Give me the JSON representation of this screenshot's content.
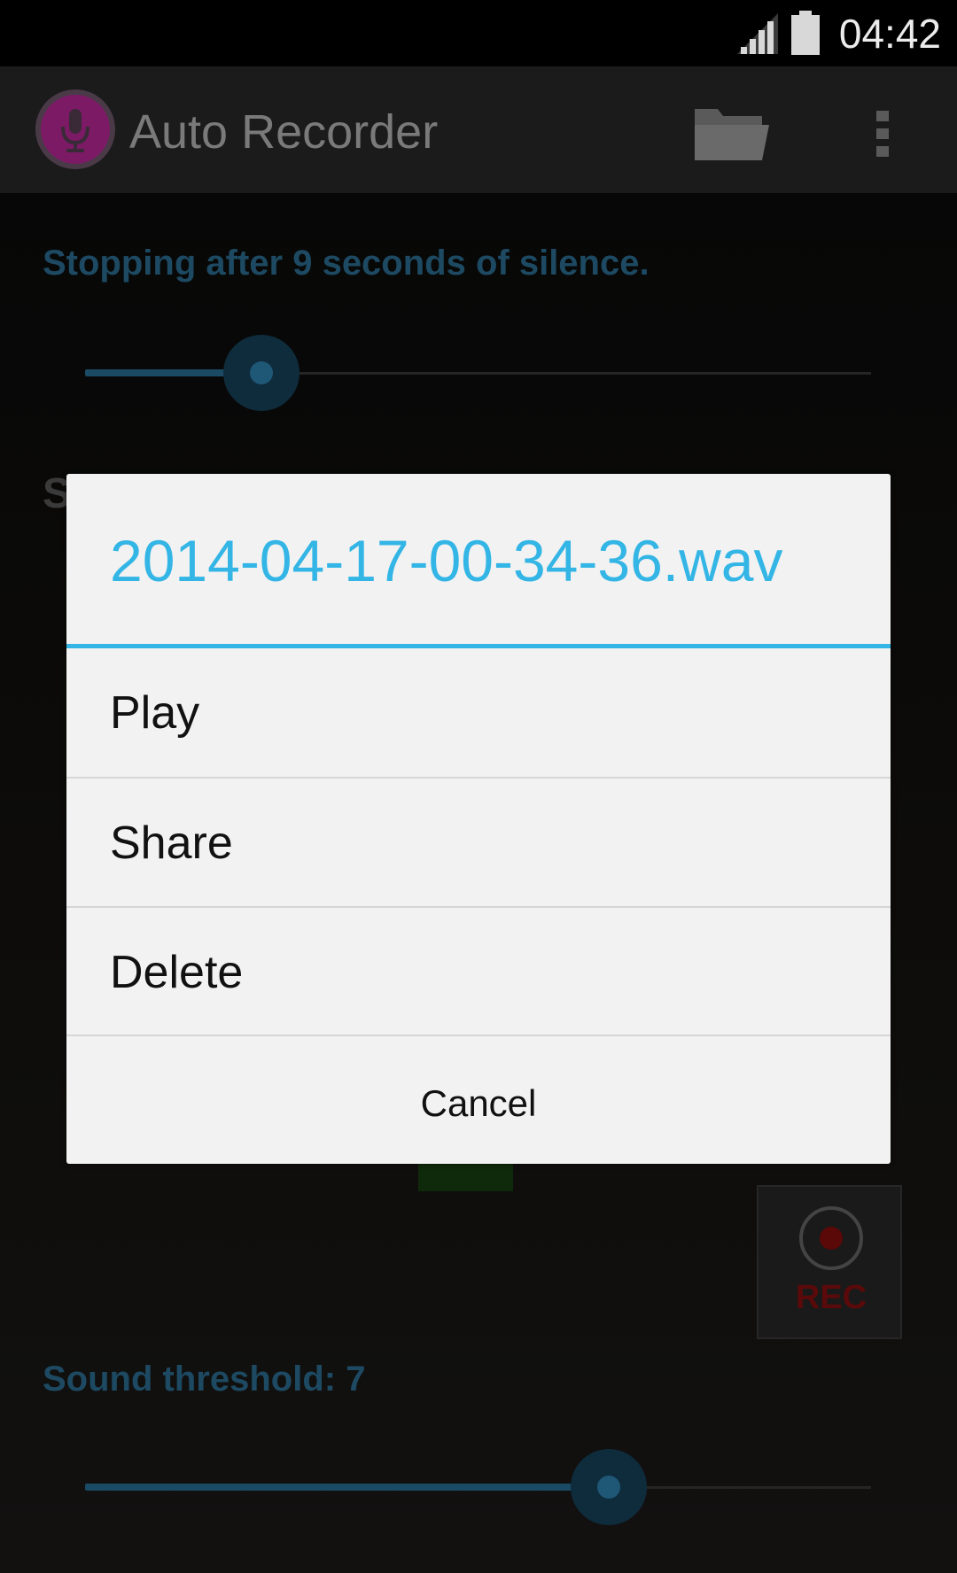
{
  "status_bar": {
    "time": "04:42"
  },
  "action_bar": {
    "title": "Auto Recorder",
    "app_icon": "microphone-icon",
    "folder_icon": "folder-icon",
    "overflow_icon": "overflow-menu-icon"
  },
  "content": {
    "silence_text": "Stopping after 9 seconds of silence.",
    "silence_slider_fraction": 0.22,
    "obscured_label": "S",
    "rec_label": "REC",
    "threshold_text": "Sound threshold: 7",
    "threshold_slider_fraction": 0.66
  },
  "dialog": {
    "title": "2014-04-17-00-34-36.wav",
    "items": [
      {
        "label": "Play"
      },
      {
        "label": "Share"
      },
      {
        "label": "Delete"
      }
    ],
    "cancel_label": "Cancel"
  },
  "colors": {
    "accent": "#33b5e5",
    "dimmed_accent": "#1d4a62",
    "rec_red": "#5a0a0a",
    "app_icon_magenta": "#8a1a6a"
  }
}
